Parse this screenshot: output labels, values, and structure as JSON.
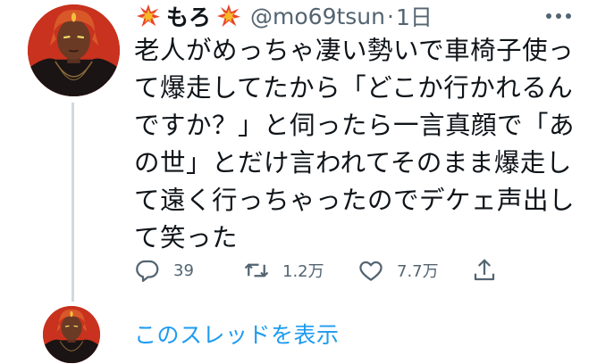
{
  "tweet": {
    "display_name": "もろ",
    "handle": "@mo69tsun",
    "separator": "·",
    "time": "1日",
    "name_emoji": "collision-emoji",
    "more_icon": "more-horizontal-icon",
    "text_lines": [
      "老人がめっちゃ凄い勢いで車椅子使っ",
      "て爆走してたから「どこか行かれるん",
      "ですか？」と伺ったら一言真顔で「あ",
      "の世」とだけ言われてそのまま爆走し",
      "て遠く行っちゃったのでデケェ声出し",
      "て笑った"
    ],
    "actions": {
      "reply": {
        "icon": "reply-icon",
        "count": "39"
      },
      "retweet": {
        "icon": "retweet-icon",
        "count": "1.2万"
      },
      "like": {
        "icon": "heart-icon",
        "count": "7.7万"
      },
      "share": {
        "icon": "share-icon"
      }
    }
  },
  "thread": {
    "show_thread_label": "このスレッドを表示"
  },
  "colors": {
    "text": "#0f1419",
    "secondary": "#536471",
    "link": "#1d9bf0",
    "thread_line": "#cfd9de",
    "avatar_bg": "#c8321e"
  }
}
